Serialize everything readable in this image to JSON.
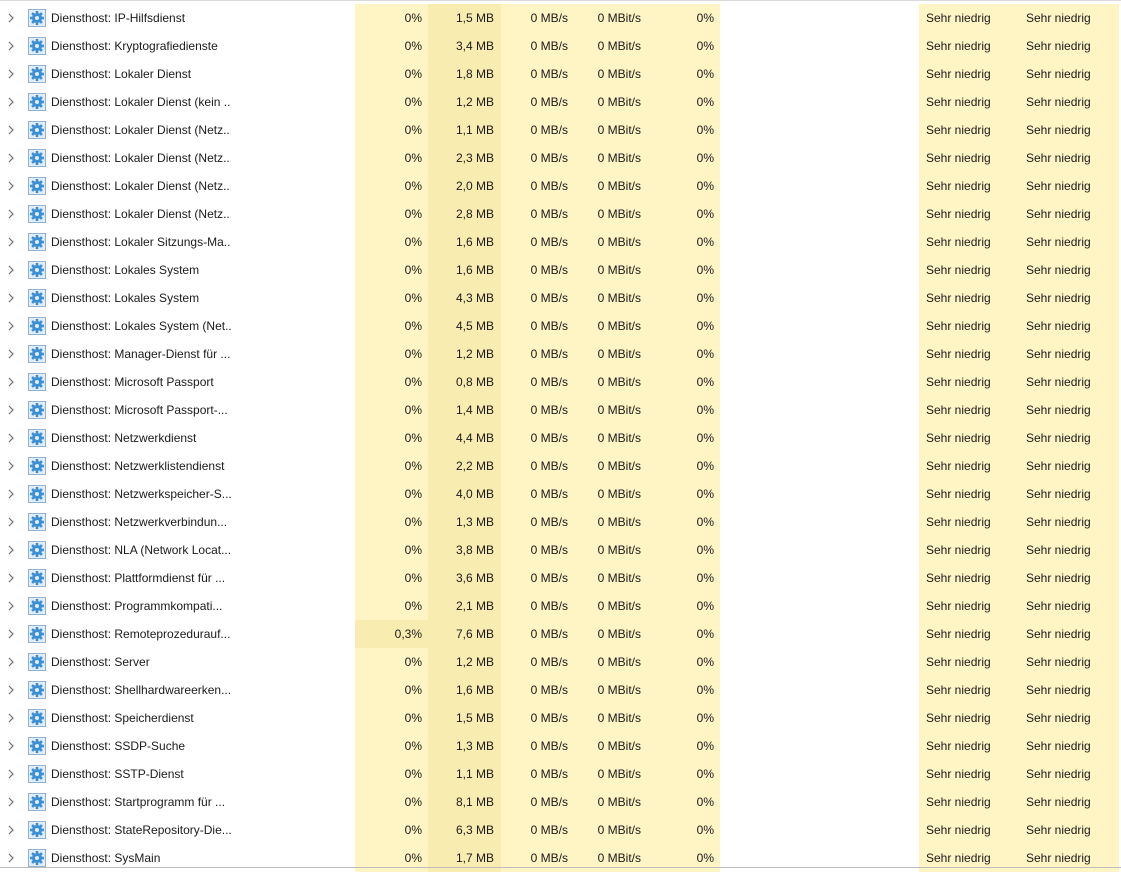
{
  "rows": [
    {
      "name": "Diensthost: IP-Hilfsdienst",
      "cpu": "0%",
      "memory": "1,5 MB",
      "disk": "0 MB/s",
      "network": "0 MBit/s",
      "gpu": "0%",
      "gpu_engine": "",
      "power": "Sehr niedrig",
      "power_trend": "Sehr niedrig"
    },
    {
      "name": "Diensthost: Kryptografiedienste",
      "cpu": "0%",
      "memory": "3,4 MB",
      "disk": "0 MB/s",
      "network": "0 MBit/s",
      "gpu": "0%",
      "gpu_engine": "",
      "power": "Sehr niedrig",
      "power_trend": "Sehr niedrig"
    },
    {
      "name": "Diensthost: Lokaler Dienst",
      "cpu": "0%",
      "memory": "1,8 MB",
      "disk": "0 MB/s",
      "network": "0 MBit/s",
      "gpu": "0%",
      "gpu_engine": "",
      "power": "Sehr niedrig",
      "power_trend": "Sehr niedrig"
    },
    {
      "name": "Diensthost: Lokaler Dienst (kein ...",
      "cpu": "0%",
      "memory": "1,2 MB",
      "disk": "0 MB/s",
      "network": "0 MBit/s",
      "gpu": "0%",
      "gpu_engine": "",
      "power": "Sehr niedrig",
      "power_trend": "Sehr niedrig"
    },
    {
      "name": "Diensthost: Lokaler Dienst (Netz...",
      "cpu": "0%",
      "memory": "1,1 MB",
      "disk": "0 MB/s",
      "network": "0 MBit/s",
      "gpu": "0%",
      "gpu_engine": "",
      "power": "Sehr niedrig",
      "power_trend": "Sehr niedrig"
    },
    {
      "name": "Diensthost: Lokaler Dienst (Netz...",
      "cpu": "0%",
      "memory": "2,3 MB",
      "disk": "0 MB/s",
      "network": "0 MBit/s",
      "gpu": "0%",
      "gpu_engine": "",
      "power": "Sehr niedrig",
      "power_trend": "Sehr niedrig"
    },
    {
      "name": "Diensthost: Lokaler Dienst (Netz...",
      "cpu": "0%",
      "memory": "2,0 MB",
      "disk": "0 MB/s",
      "network": "0 MBit/s",
      "gpu": "0%",
      "gpu_engine": "",
      "power": "Sehr niedrig",
      "power_trend": "Sehr niedrig"
    },
    {
      "name": "Diensthost: Lokaler Dienst (Netz...",
      "cpu": "0%",
      "memory": "2,8 MB",
      "disk": "0 MB/s",
      "network": "0 MBit/s",
      "gpu": "0%",
      "gpu_engine": "",
      "power": "Sehr niedrig",
      "power_trend": "Sehr niedrig"
    },
    {
      "name": "Diensthost: Lokaler Sitzungs-Ma...",
      "cpu": "0%",
      "memory": "1,6 MB",
      "disk": "0 MB/s",
      "network": "0 MBit/s",
      "gpu": "0%",
      "gpu_engine": "",
      "power": "Sehr niedrig",
      "power_trend": "Sehr niedrig"
    },
    {
      "name": "Diensthost: Lokales System",
      "cpu": "0%",
      "memory": "1,6 MB",
      "disk": "0 MB/s",
      "network": "0 MBit/s",
      "gpu": "0%",
      "gpu_engine": "",
      "power": "Sehr niedrig",
      "power_trend": "Sehr niedrig"
    },
    {
      "name": "Diensthost: Lokales System",
      "cpu": "0%",
      "memory": "4,3 MB",
      "disk": "0 MB/s",
      "network": "0 MBit/s",
      "gpu": "0%",
      "gpu_engine": "",
      "power": "Sehr niedrig",
      "power_trend": "Sehr niedrig"
    },
    {
      "name": "Diensthost: Lokales System (Net...",
      "cpu": "0%",
      "memory": "4,5 MB",
      "disk": "0 MB/s",
      "network": "0 MBit/s",
      "gpu": "0%",
      "gpu_engine": "",
      "power": "Sehr niedrig",
      "power_trend": "Sehr niedrig"
    },
    {
      "name": "Diensthost: Manager-Dienst für ...",
      "cpu": "0%",
      "memory": "1,2 MB",
      "disk": "0 MB/s",
      "network": "0 MBit/s",
      "gpu": "0%",
      "gpu_engine": "",
      "power": "Sehr niedrig",
      "power_trend": "Sehr niedrig"
    },
    {
      "name": "Diensthost: Microsoft Passport",
      "cpu": "0%",
      "memory": "0,8 MB",
      "disk": "0 MB/s",
      "network": "0 MBit/s",
      "gpu": "0%",
      "gpu_engine": "",
      "power": "Sehr niedrig",
      "power_trend": "Sehr niedrig"
    },
    {
      "name": "Diensthost: Microsoft Passport-...",
      "cpu": "0%",
      "memory": "1,4 MB",
      "disk": "0 MB/s",
      "network": "0 MBit/s",
      "gpu": "0%",
      "gpu_engine": "",
      "power": "Sehr niedrig",
      "power_trend": "Sehr niedrig"
    },
    {
      "name": "Diensthost: Netzwerkdienst",
      "cpu": "0%",
      "memory": "4,4 MB",
      "disk": "0 MB/s",
      "network": "0 MBit/s",
      "gpu": "0%",
      "gpu_engine": "",
      "power": "Sehr niedrig",
      "power_trend": "Sehr niedrig"
    },
    {
      "name": "Diensthost: Netzwerklistendienst",
      "cpu": "0%",
      "memory": "2,2 MB",
      "disk": "0 MB/s",
      "network": "0 MBit/s",
      "gpu": "0%",
      "gpu_engine": "",
      "power": "Sehr niedrig",
      "power_trend": "Sehr niedrig"
    },
    {
      "name": "Diensthost: Netzwerkspeicher-S...",
      "cpu": "0%",
      "memory": "4,0 MB",
      "disk": "0 MB/s",
      "network": "0 MBit/s",
      "gpu": "0%",
      "gpu_engine": "",
      "power": "Sehr niedrig",
      "power_trend": "Sehr niedrig"
    },
    {
      "name": "Diensthost: Netzwerkverbindun...",
      "cpu": "0%",
      "memory": "1,3 MB",
      "disk": "0 MB/s",
      "network": "0 MBit/s",
      "gpu": "0%",
      "gpu_engine": "",
      "power": "Sehr niedrig",
      "power_trend": "Sehr niedrig"
    },
    {
      "name": "Diensthost: NLA (Network Locat...",
      "cpu": "0%",
      "memory": "3,8 MB",
      "disk": "0 MB/s",
      "network": "0 MBit/s",
      "gpu": "0%",
      "gpu_engine": "",
      "power": "Sehr niedrig",
      "power_trend": "Sehr niedrig"
    },
    {
      "name": "Diensthost: Plattformdienst für ...",
      "cpu": "0%",
      "memory": "3,6 MB",
      "disk": "0 MB/s",
      "network": "0 MBit/s",
      "gpu": "0%",
      "gpu_engine": "",
      "power": "Sehr niedrig",
      "power_trend": "Sehr niedrig"
    },
    {
      "name": "Diensthost: Programmkompati...",
      "cpu": "0%",
      "memory": "2,1 MB",
      "disk": "0 MB/s",
      "network": "0 MBit/s",
      "gpu": "0%",
      "gpu_engine": "",
      "power": "Sehr niedrig",
      "power_trend": "Sehr niedrig"
    },
    {
      "name": "Diensthost: Remoteprozedurauf...",
      "cpu": "0,3%",
      "memory": "7,6 MB",
      "disk": "0 MB/s",
      "network": "0 MBit/s",
      "gpu": "0%",
      "gpu_engine": "",
      "power": "Sehr niedrig",
      "power_trend": "Sehr niedrig",
      "cpu_hot": true
    },
    {
      "name": "Diensthost: Server",
      "cpu": "0%",
      "memory": "1,2 MB",
      "disk": "0 MB/s",
      "network": "0 MBit/s",
      "gpu": "0%",
      "gpu_engine": "",
      "power": "Sehr niedrig",
      "power_trend": "Sehr niedrig"
    },
    {
      "name": "Diensthost: Shellhardwareerken...",
      "cpu": "0%",
      "memory": "1,6 MB",
      "disk": "0 MB/s",
      "network": "0 MBit/s",
      "gpu": "0%",
      "gpu_engine": "",
      "power": "Sehr niedrig",
      "power_trend": "Sehr niedrig"
    },
    {
      "name": "Diensthost: Speicherdienst",
      "cpu": "0%",
      "memory": "1,5 MB",
      "disk": "0 MB/s",
      "network": "0 MBit/s",
      "gpu": "0%",
      "gpu_engine": "",
      "power": "Sehr niedrig",
      "power_trend": "Sehr niedrig"
    },
    {
      "name": "Diensthost: SSDP-Suche",
      "cpu": "0%",
      "memory": "1,3 MB",
      "disk": "0 MB/s",
      "network": "0 MBit/s",
      "gpu": "0%",
      "gpu_engine": "",
      "power": "Sehr niedrig",
      "power_trend": "Sehr niedrig"
    },
    {
      "name": "Diensthost: SSTP-Dienst",
      "cpu": "0%",
      "memory": "1,1 MB",
      "disk": "0 MB/s",
      "network": "0 MBit/s",
      "gpu": "0%",
      "gpu_engine": "",
      "power": "Sehr niedrig",
      "power_trend": "Sehr niedrig"
    },
    {
      "name": "Diensthost: Startprogramm für ...",
      "cpu": "0%",
      "memory": "8,1 MB",
      "disk": "0 MB/s",
      "network": "0 MBit/s",
      "gpu": "0%",
      "gpu_engine": "",
      "power": "Sehr niedrig",
      "power_trend": "Sehr niedrig"
    },
    {
      "name": "Diensthost: StateRepository-Die...",
      "cpu": "0%",
      "memory": "6,3 MB",
      "disk": "0 MB/s",
      "network": "0 MBit/s",
      "gpu": "0%",
      "gpu_engine": "",
      "power": "Sehr niedrig",
      "power_trend": "Sehr niedrig"
    },
    {
      "name": "Diensthost: SysMain",
      "cpu": "0%",
      "memory": "1,7 MB",
      "disk": "0 MB/s",
      "network": "0 MBit/s",
      "gpu": "0%",
      "gpu_engine": "",
      "power": "Sehr niedrig",
      "power_trend": "Sehr niedrig"
    }
  ],
  "colors": {
    "cell_light": "#fff4c4",
    "cell_medium": "#f9ecb0",
    "gear_icon": "#3b8fd6"
  },
  "icons": {
    "expand": "chevron-right-icon",
    "process": "gear-icon"
  }
}
